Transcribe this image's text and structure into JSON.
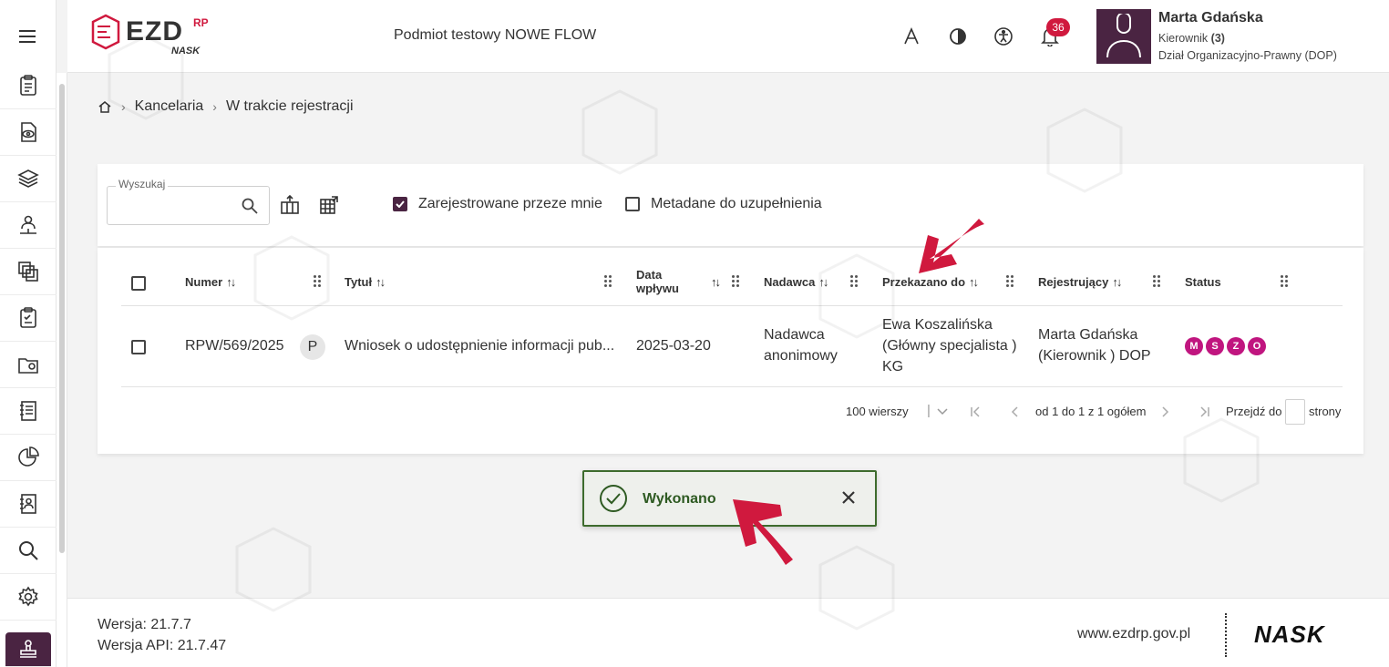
{
  "header": {
    "org_name": "Podmiot testowy NOWE FLOW",
    "notification_count": "36",
    "user": {
      "name": "Marta Gdańska",
      "role": "Kierownik",
      "role_count": "(3)",
      "department": "Dział Organizacyjno-Prawny (DOP)"
    }
  },
  "logo": {
    "text": "EZD",
    "superscript": "RP",
    "sub": "NASK"
  },
  "breadcrumb": {
    "items": [
      "Kancelaria",
      "W trakcie rejestracji"
    ]
  },
  "toolbar": {
    "search_label": "Wyszukaj",
    "search_value": "",
    "filter_registered_by_me": {
      "label": "Zarejestrowane przeze mnie",
      "checked": true
    },
    "filter_metadata": {
      "label": "Metadane do uzupełnienia",
      "checked": false
    }
  },
  "table": {
    "columns": {
      "numer": "Numer",
      "tytul": "Tytuł",
      "data_line1": "Data",
      "data_line2": "wpływu",
      "nadawca": "Nadawca",
      "przekazano": "Przekazano do",
      "rejestrujacy": "Rejestrujący",
      "status": "Status"
    },
    "rows": [
      {
        "numer": "RPW/569/2025",
        "badge": "P",
        "tytul": "Wniosek o udostępnienie informacji pub...",
        "data": "2025-03-20",
        "nadawca_line1": "Nadawca",
        "nadawca_line2": "anonimowy",
        "przekazano_line1": "Ewa Koszalińska",
        "przekazano_line2": "(Główny specjalista )",
        "przekazano_line3": "KG",
        "rejestrujacy_line1": "Marta Gdańska",
        "rejestrujacy_line2": "(Kierownik ) DOP",
        "status": [
          "M",
          "S",
          "Z",
          "O"
        ]
      }
    ]
  },
  "pagination": {
    "rows_per_page": "100 wierszy",
    "range": "od 1 do 1 z 1 ogółem",
    "goto_label": "Przejdź do",
    "goto_suffix": "strony"
  },
  "toast": {
    "message": "Wykonano"
  },
  "footer": {
    "version": "Wersja: 21.7.7",
    "api_version": "Wersja API: 21.7.47",
    "site": "www.ezdrp.gov.pl",
    "brand": "NASK"
  },
  "colors": {
    "primary": "#4a2442",
    "badge": "#d0193e",
    "status": "#c0157f",
    "toast_border": "#3d6b2d",
    "arrow": "#d0193e"
  }
}
